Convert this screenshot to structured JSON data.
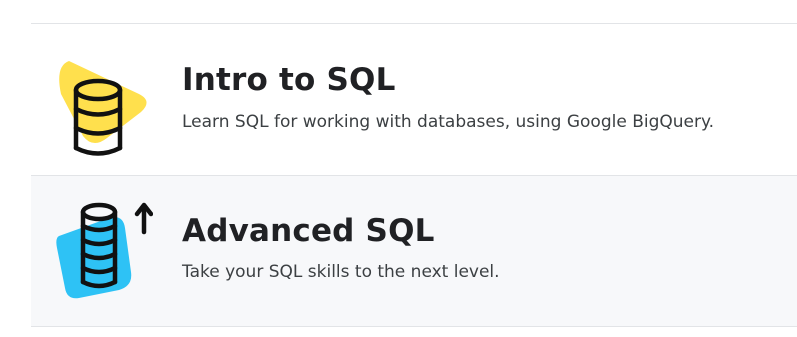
{
  "courses": [
    {
      "title": "Intro to SQL",
      "description": "Learn SQL for working with databases, using Google BigQuery.",
      "icon": "database-icon",
      "accent_color": "#ffe04d"
    },
    {
      "title": "Advanced SQL",
      "description": "Take your SQL skills to the next level.",
      "icon": "database-arrow-up-icon",
      "accent_color": "#2ec2f5"
    }
  ],
  "colors": {
    "divider": "#e2e4e7",
    "highlight_row_bg": "#f7f8fa",
    "title_text": "#202124",
    "description_text": "#3c4043"
  }
}
